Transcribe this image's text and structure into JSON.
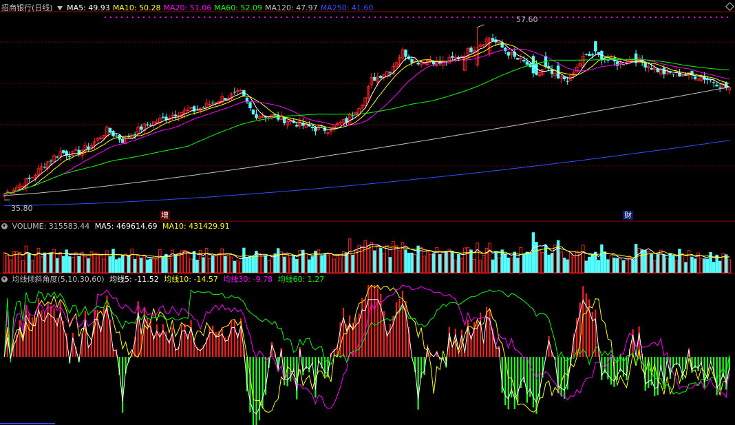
{
  "header": {
    "title": "招商银行(日线)",
    "ma_labels": [
      {
        "text": "MA5: 49.93",
        "color": "#ffffff"
      },
      {
        "text": "MA10: 50.28",
        "color": "#ffff00"
      },
      {
        "text": "MA20: 51.06",
        "color": "#ff00ff"
      },
      {
        "text": "MA60: 52.09",
        "color": "#00ff00"
      },
      {
        "text": "MA120: 47.97",
        "color": "#c0c0c0"
      },
      {
        "text": "MA250: 41.60",
        "color": "#3050ff"
      }
    ]
  },
  "volume_header": {
    "title": "VOLUME: 315583.44",
    "ma5": "MA5: 469614.69",
    "ma10": "MA10: 431429.91"
  },
  "angle_header": {
    "title": "均线倾斜角度(5,10,30,60)",
    "l5": "均线5: -11.52",
    "l10": "均线10: -14.57",
    "l30": "均线30: -9.78",
    "l60": "均线60: 1.27"
  },
  "markers": {
    "zeng": "增",
    "cai": "财"
  },
  "colors": {
    "up": "#ff2020",
    "down": "#54ffff",
    "ma5": "#ffffff",
    "ma10": "#ffff00",
    "ma20": "#ff00ff",
    "ma60": "#00ff00",
    "ma120": "#c0c0c0",
    "ma250": "#3050ff",
    "grid": "#7a0000",
    "hist_up": "#ff2020",
    "hist_down": "#20ff20"
  },
  "chart_data": {
    "type": "candlestick",
    "title": "招商银行(日线)",
    "price_high_label": "57.60",
    "price_low_label": "35.80",
    "ylim": [
      34.5,
      59.5
    ],
    "anchors": [
      [
        0,
        36.4
      ],
      [
        8,
        38.2
      ],
      [
        14,
        40.5
      ],
      [
        18,
        41.7
      ],
      [
        22,
        41.4
      ],
      [
        28,
        42.6
      ],
      [
        33,
        44.5
      ],
      [
        38,
        43.2
      ],
      [
        44,
        44.8
      ],
      [
        50,
        45.8
      ],
      [
        56,
        46.8
      ],
      [
        62,
        47.1
      ],
      [
        70,
        48.6
      ],
      [
        76,
        49.2
      ],
      [
        80,
        46.5
      ],
      [
        86,
        46.3
      ],
      [
        92,
        45.6
      ],
      [
        96,
        45.1
      ],
      [
        100,
        44.7
      ],
      [
        104,
        44.6
      ],
      [
        110,
        45.7
      ],
      [
        116,
        48.6
      ],
      [
        118,
        50.9
      ],
      [
        124,
        52.2
      ],
      [
        128,
        54.5
      ],
      [
        132,
        53.2
      ],
      [
        137,
        53.5
      ],
      [
        140,
        53.0
      ],
      [
        146,
        53.8
      ],
      [
        152,
        55.3
      ],
      [
        156,
        56.3
      ],
      [
        160,
        55.0
      ],
      [
        164,
        53.7
      ],
      [
        168,
        52.9
      ],
      [
        170,
        51.4
      ],
      [
        174,
        52.3
      ],
      [
        178,
        51.0
      ],
      [
        182,
        51.1
      ],
      [
        186,
        53.7
      ],
      [
        190,
        54.2
      ],
      [
        194,
        53.4
      ],
      [
        198,
        52.9
      ],
      [
        202,
        53.7
      ],
      [
        208,
        52.5
      ],
      [
        212,
        51.8
      ],
      [
        218,
        51.6
      ],
      [
        224,
        51.3
      ],
      [
        228,
        50.7
      ],
      [
        232,
        49.9
      ]
    ],
    "big_candles": [
      [
        148,
        1.8
      ],
      [
        152,
        2.2
      ],
      [
        156,
        2.0
      ],
      [
        170,
        -2.2
      ],
      [
        171,
        -1.5
      ],
      [
        174,
        -1.4
      ],
      [
        178,
        -1.6
      ],
      [
        186,
        1.4
      ],
      [
        190,
        -1.3
      ],
      [
        192,
        -1.2
      ],
      [
        203,
        -1.2
      ]
    ],
    "ma_periods": [
      5,
      10,
      20,
      60,
      120,
      250
    ],
    "ma120_range": [
      36.2,
      50.0
    ],
    "ma250_range": [
      34.9,
      43.2
    ],
    "last_values": {
      "MA5": 49.93,
      "MA10": 50.28,
      "MA20": 51.06,
      "MA60": 52.09,
      "MA120": 47.97,
      "MA250": 41.6
    },
    "volume": {
      "last": 315583.44,
      "ma5": 469614.69,
      "ma10": 431429.91,
      "ylim": [
        0,
        1000000
      ]
    },
    "angle": {
      "series": [
        {
          "name": "均线5",
          "last": -11.52
        },
        {
          "name": "均线10",
          "last": -14.57
        },
        {
          "name": "均线30",
          "last": -9.78
        },
        {
          "name": "均线60",
          "last": 1.27
        }
      ],
      "ylim": [
        -60,
        60
      ]
    }
  }
}
